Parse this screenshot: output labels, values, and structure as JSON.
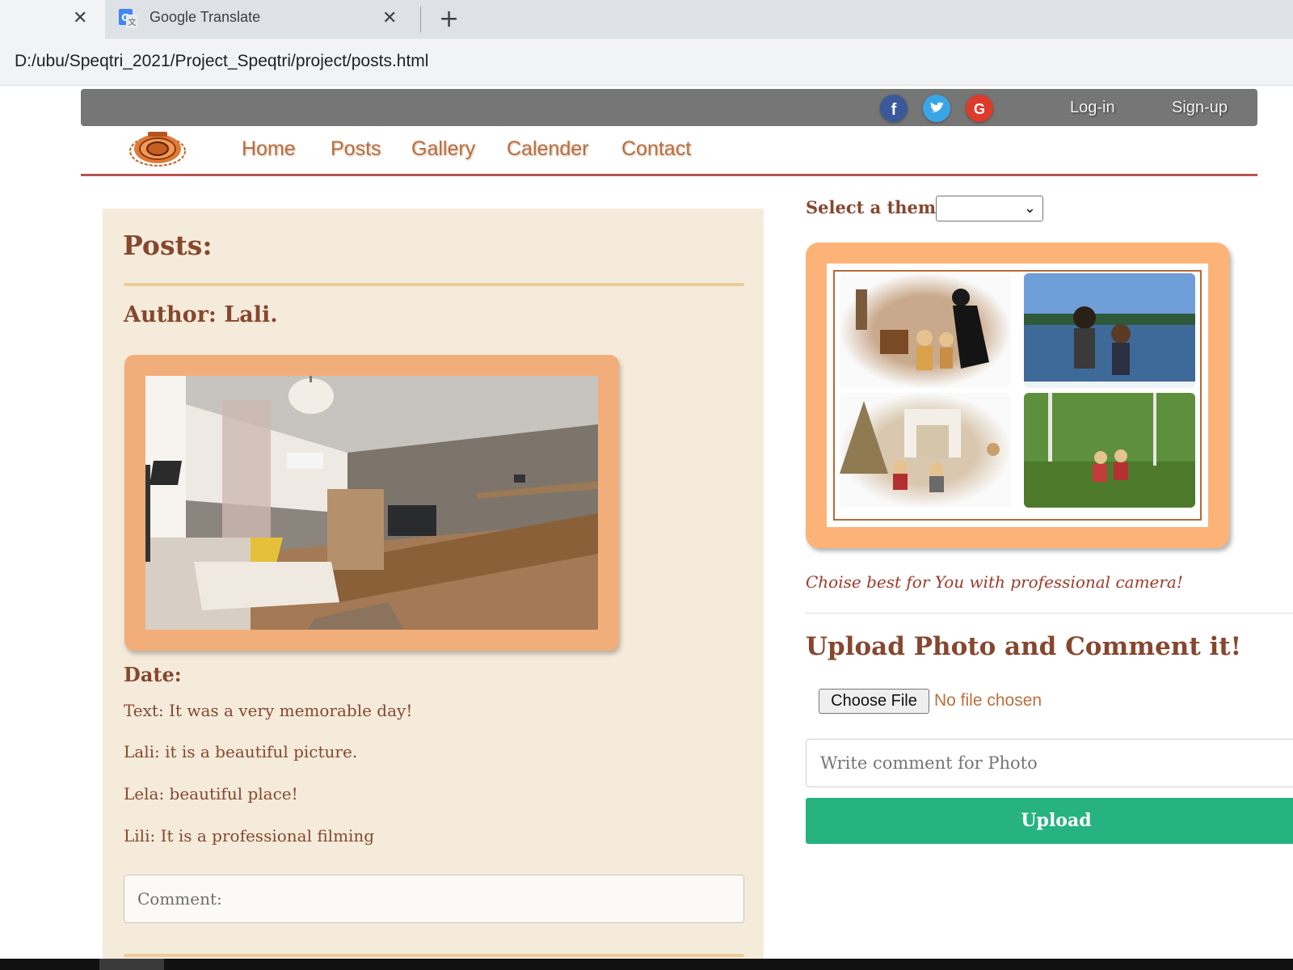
{
  "browser": {
    "tabs": [
      {
        "title": "",
        "active": true
      },
      {
        "title": "Google Translate",
        "active": false,
        "icon": "google-translate-icon"
      }
    ],
    "address": "D:/ubu/Speqtri_2021/Project_Speqtri/project/posts.html"
  },
  "topbar": {
    "social": [
      "facebook-icon",
      "twitter-icon",
      "google-icon"
    ],
    "login": "Log-in",
    "signup": "Sign-up"
  },
  "nav": {
    "items": [
      "Home",
      "Posts",
      "Gallery",
      "Calender",
      "Contact"
    ]
  },
  "posts": {
    "title": "Posts:",
    "author": "Author: Lali.",
    "date_label": "Date:",
    "text": "Text: It was a very memorable day!",
    "comments": [
      "Lali: it is a beautiful picture.",
      "Lela: beautiful place!",
      "Lili: It is a professional filming"
    ],
    "comment_placeholder": "Comment:"
  },
  "sidebar": {
    "theme_label": "Select a theme:",
    "theme_value": "",
    "tagline": "Choise best for You with professional camera!",
    "upload_title": "Upload Photo and Comment it!",
    "choose_file": "Choose File",
    "no_file": "No file chosen",
    "photo_comment_placeholder": "Write comment for Photo",
    "upload_button": "Upload"
  },
  "colors": {
    "brand_brown": "#86472f",
    "nav_orange": "#b96f3d",
    "panel_bg": "#f5ebdb",
    "frame_orange": "#f2ae7a",
    "upload_green": "#26b37f"
  }
}
